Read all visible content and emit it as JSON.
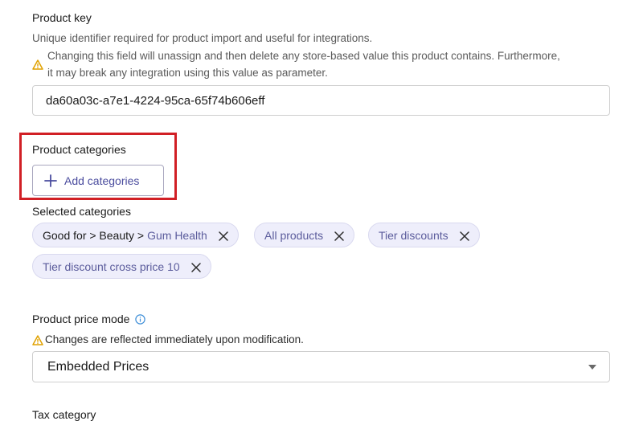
{
  "product_key": {
    "label": "Product key",
    "help": "Unique identifier required for product import and useful for integrations.",
    "warning_line1": "Changing this field will unassign and then delete any store-based value this product contains. Furthermore,",
    "warning_line2": "it may break any integration using this value as parameter.",
    "value": "da60a03c-a7e1-4224-95ca-65f74b606eff"
  },
  "product_categories": {
    "label": "Product categories",
    "add_button_label": "Add categories"
  },
  "selected_categories": {
    "label": "Selected categories",
    "chips": [
      {
        "path": "Good for > Beauty > ",
        "label": "Gum Health"
      },
      {
        "path": "",
        "label": "All products"
      },
      {
        "path": "",
        "label": "Tier discounts"
      },
      {
        "path": "",
        "label": "Tier discount cross price 10"
      }
    ]
  },
  "price_mode": {
    "label": "Product price mode",
    "warning": "Changes are reflected immediately upon modification.",
    "selected": "Embedded Prices"
  },
  "tax_category": {
    "label": "Tax category"
  },
  "colors": {
    "accent": "#4a4c9e",
    "highlight": "#d11f25",
    "warning": "#e0a100",
    "info": "#3f8fd8"
  }
}
